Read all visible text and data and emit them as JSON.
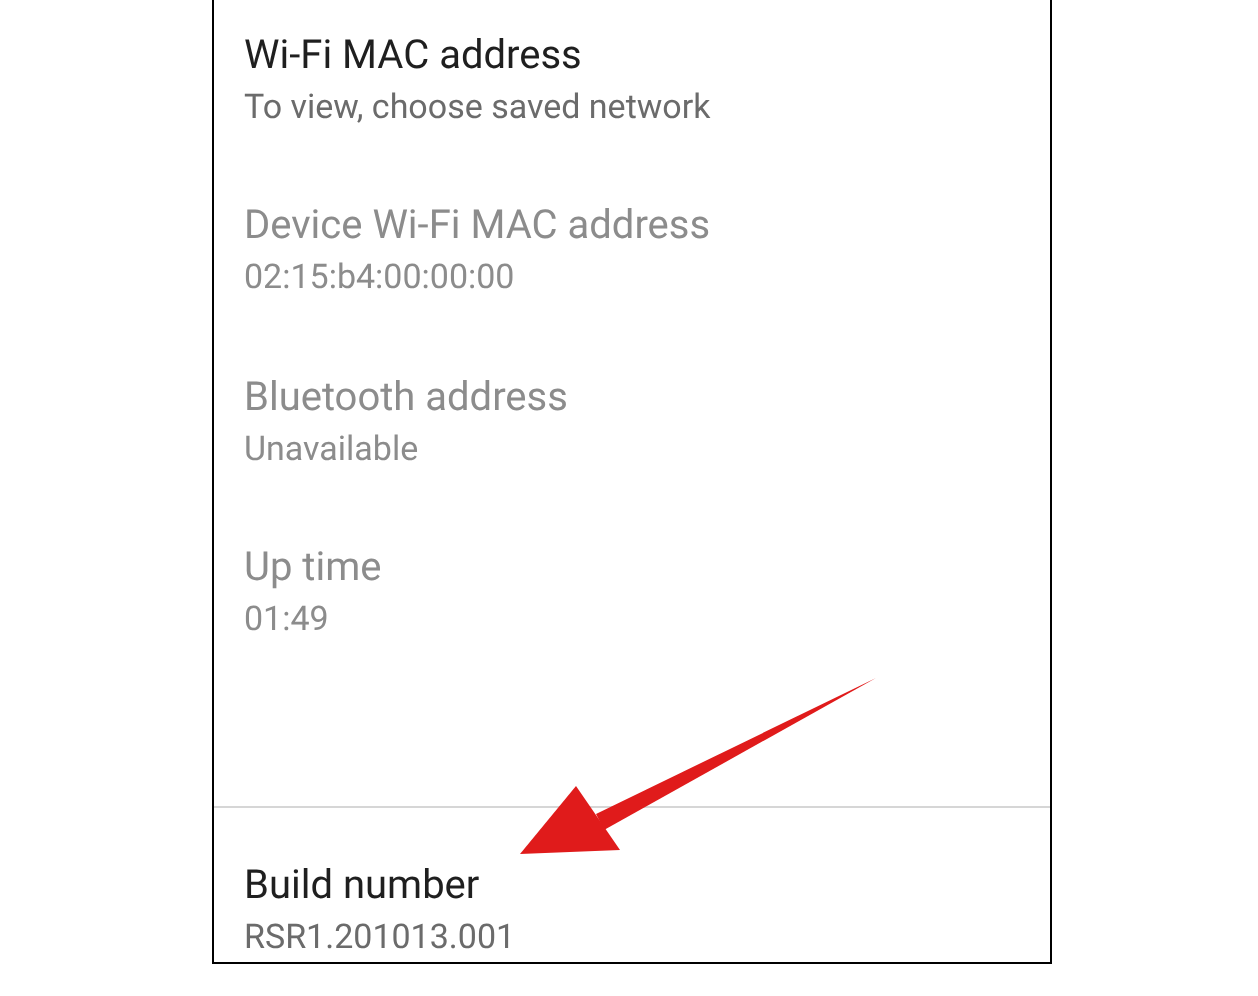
{
  "items": [
    {
      "title": "Wi-Fi MAC address",
      "summary": "To view, choose saved network",
      "disabled": false
    },
    {
      "title": "Device Wi-Fi MAC address",
      "summary": "02:15:b4:00:00:00",
      "disabled": true
    },
    {
      "title": "Bluetooth address",
      "summary": "Unavailable",
      "disabled": true
    },
    {
      "title": "Up time",
      "summary": "01:49",
      "disabled": true
    }
  ],
  "footer_item": {
    "title": "Build number",
    "summary": "RSR1.201013.001",
    "disabled": false
  }
}
